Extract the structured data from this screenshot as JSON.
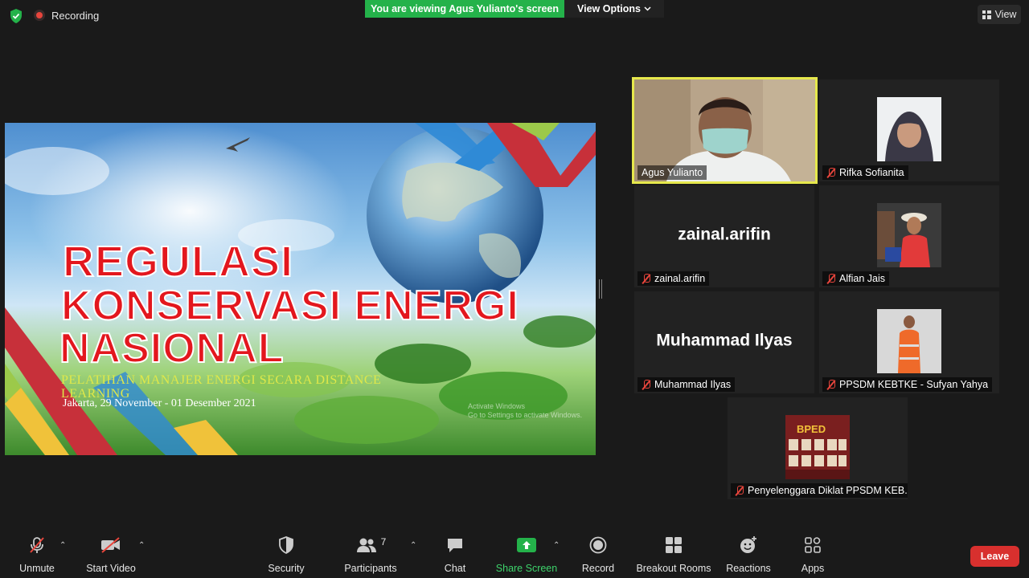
{
  "topbar": {
    "recording_label": "Recording",
    "viewing_banner": "You are viewing Agus Yulianto's screen",
    "view_options_label": "View Options",
    "view_label": "View"
  },
  "slide": {
    "title_line1": "REGULASI",
    "title_line2": "KONSERVASI ENERGI",
    "title_line3": "NASIONAL",
    "subtitle": "PELATIHAN MANAJER ENERGI SECARA DISTANCE LEARNING",
    "date": "Jakarta, 29 November - 01 Desember 2021",
    "watermark_line1": "Activate Windows",
    "watermark_line2": "Go to Settings to activate Windows."
  },
  "participants": [
    {
      "name": "Agus Yulianto",
      "muted": false,
      "video": true,
      "active": true
    },
    {
      "name": "Rifka Sofianita",
      "muted": true,
      "video": false
    },
    {
      "name": "zainal.arifin",
      "muted": true,
      "video": false,
      "display_text": "zainal.arifin"
    },
    {
      "name": "Alfian Jais",
      "muted": true,
      "video": false
    },
    {
      "name": "Muhammad Ilyas",
      "muted": true,
      "video": false,
      "display_text": "Muhammad Ilyas"
    },
    {
      "name": "PPSDM KEBTKE - Sufyan Yahya",
      "muted": true,
      "video": false
    },
    {
      "name": "Penyelenggara Diklat PPSDM KEB...",
      "muted": true,
      "video": false,
      "avatar_text": "BPED"
    }
  ],
  "toolbar": {
    "unmute": "Unmute",
    "start_video": "Start Video",
    "security": "Security",
    "participants": "Participants",
    "participants_count": "7",
    "chat": "Chat",
    "share_screen": "Share Screen",
    "record": "Record",
    "breakout_rooms": "Breakout Rooms",
    "reactions": "Reactions",
    "apps": "Apps",
    "leave": "Leave"
  },
  "colors": {
    "active_speaker": "#e6e84c",
    "banner_green": "#24b24a",
    "leave_red": "#d8302e",
    "title_red": "#e3171e"
  }
}
